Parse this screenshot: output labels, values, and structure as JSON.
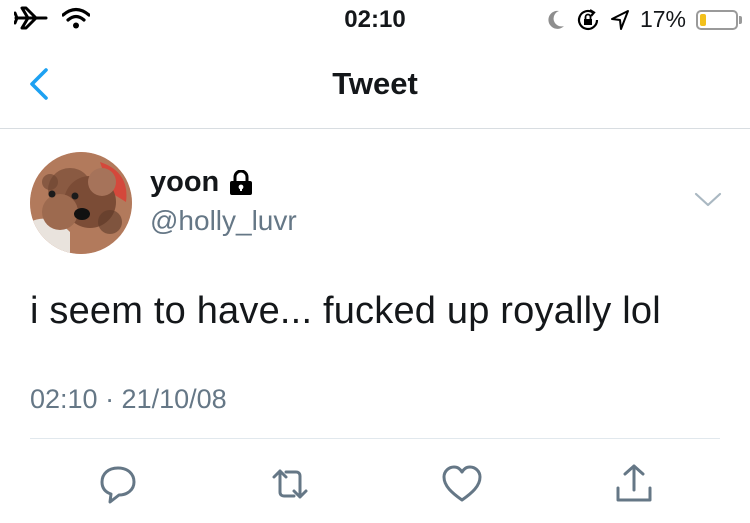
{
  "status_bar": {
    "time": "02:10",
    "battery_percent_label": "17%",
    "battery_level": 0.17,
    "icons": [
      "airplane-icon",
      "wifi-icon",
      "moon-icon",
      "rotation-lock-icon",
      "location-arrow-icon",
      "battery-icon"
    ]
  },
  "nav": {
    "title": "Tweet",
    "back_icon": "chevron-left-icon"
  },
  "tweet": {
    "author_name": "yoon",
    "author_handle": "@holly_luvr",
    "protected_icon": "lock-icon",
    "text": "i seem to have... fucked up royally lol",
    "timestamp": "02:10 · 21/10/08"
  },
  "actions": [
    "reply-icon",
    "retweet-icon",
    "like-icon",
    "share-icon"
  ],
  "colors": {
    "accent": "#1da1f2",
    "secondary_text": "#657786",
    "battery_low": "#f2c01c"
  }
}
